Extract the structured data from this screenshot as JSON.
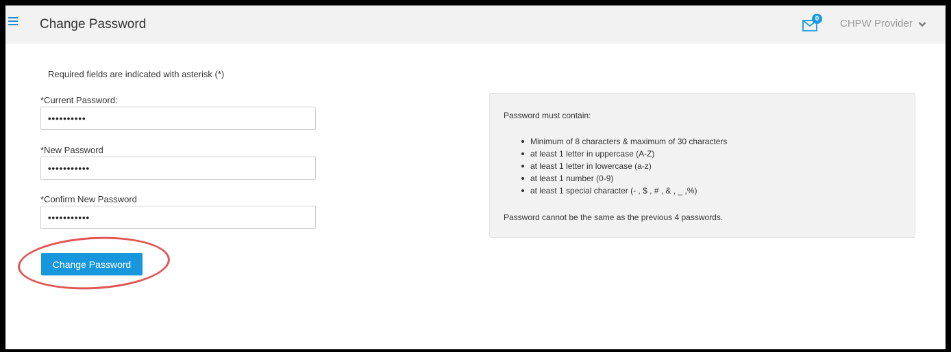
{
  "header": {
    "title": "Change Password",
    "menu_icon": "hamburger-menu-icon",
    "mail_icon": "envelope-icon",
    "mail_count": "0",
    "user_name": "CHPW Provider",
    "user_menu_icon": "chevron-down-icon"
  },
  "form": {
    "required_note": "Required fields are indicated with asterisk (*)",
    "current_password": {
      "label": "*Current Password:",
      "value": "••••••••••"
    },
    "new_password": {
      "label": "*New Password",
      "value": "•••••••••••"
    },
    "confirm_password": {
      "label": "*Confirm New Password",
      "value": "•••••••••••"
    },
    "submit_label": "Change Password"
  },
  "rules": {
    "heading": "Password must contain:",
    "items": [
      "Minimum of 8 characters & maximum of 30 characters",
      "at least 1 letter in uppercase (A-Z)",
      "at least 1 letter in lowercase (a-z)",
      "at least 1 number (0-9)",
      "at least 1 special character (- , $ , # , & , _ ,%)"
    ],
    "footer": "Password cannot be the same as the previous 4 passwords."
  },
  "colors": {
    "accent": "#1997dd",
    "highlight": "#e05454",
    "topbar": "#f2f2f2"
  }
}
